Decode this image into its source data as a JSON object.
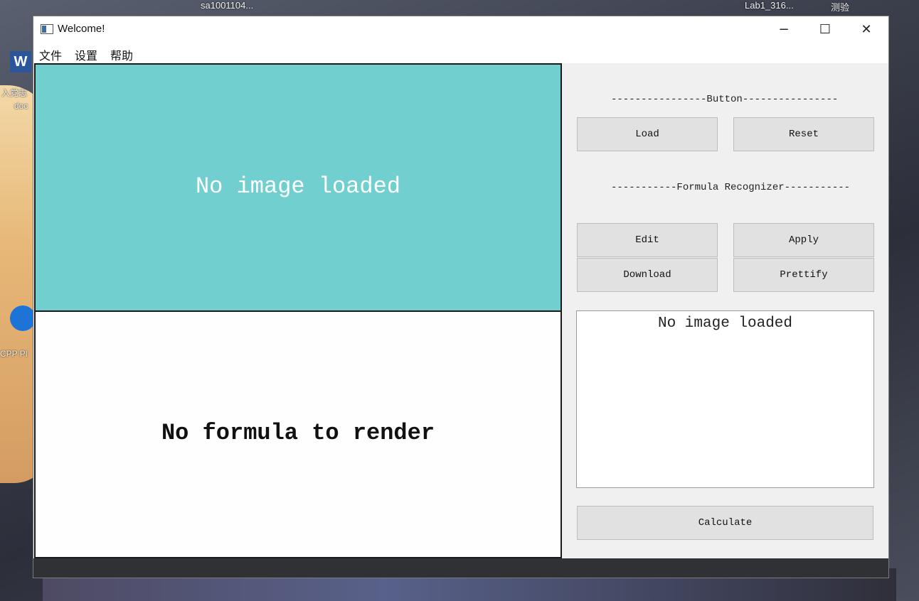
{
  "desktop": {
    "labels": {
      "top1": "sa1001104...",
      "top2": "Lab1_316...",
      "top3": "测验",
      "left1": "入党志",
      "left2": "doc",
      "left3": "CPP Pl"
    }
  },
  "window": {
    "title": "Welcome!",
    "controls": {
      "minimize": "−",
      "maximize": "☐",
      "close": "✕"
    }
  },
  "menu": {
    "items": [
      {
        "label": "文件"
      },
      {
        "label": "设置"
      },
      {
        "label": "帮助"
      }
    ]
  },
  "image_panel": {
    "status": "No image loaded"
  },
  "formula_panel": {
    "status": "No formula to render"
  },
  "sidebar": {
    "button_section_label": "----------------Button----------------",
    "load": "Load",
    "reset": "Reset",
    "recognizer_section_label": "-----------Formula Recognizer-----------",
    "edit": "Edit",
    "apply": "Apply",
    "download": "Download",
    "prettify": "Prettify",
    "output_text": "No image loaded",
    "calculate": "Calculate"
  },
  "colors": {
    "image_panel_bg": "#72cfd0",
    "button_bg": "#e1e1e1",
    "window_bg": "#f0f0f0"
  }
}
